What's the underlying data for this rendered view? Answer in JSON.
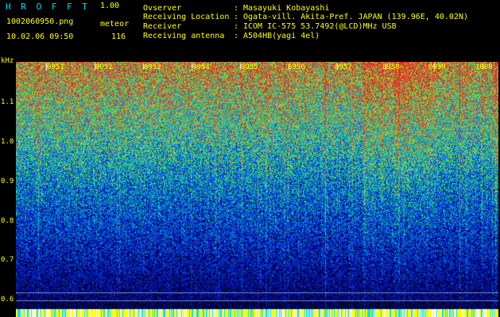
{
  "header": {
    "app_title": "H R O F F T",
    "version": "1.00",
    "filename": "1002060950.png",
    "meteor_label": "meteor",
    "datetime": "10.02.06 09:50",
    "meteor_count": "116"
  },
  "info": [
    {
      "key": "Ovserver",
      "sep": ":",
      "value": "Masayuki Kobayashi"
    },
    {
      "key": "Receiving Location",
      "sep": ":",
      "value": "Ogata-vill. Akita-Pref. JAPAN (139.96E, 40.02N)"
    },
    {
      "key": "Receiver",
      "sep": ":",
      "value": "ICOM IC-575 53.7492(@LCD)MHz USB"
    },
    {
      "key": "Receiving antenna",
      "sep": ":",
      "value": "A504HB(yagi 4el)"
    }
  ],
  "spectrogram": {
    "y_unit": "kHz",
    "y_ticks": [
      "1.1",
      "1.0",
      "0.9",
      "0.8",
      "0.7",
      "0.6"
    ],
    "x_ticks": [
      "0951",
      "0952",
      "0953",
      "0954",
      "0955",
      "0956",
      "0957",
      "0958",
      "0959",
      "1000"
    ],
    "colors": {
      "background": "#000000",
      "text": "#ffff00",
      "title": "#00d8ff",
      "tick": "#ffffff"
    }
  }
}
